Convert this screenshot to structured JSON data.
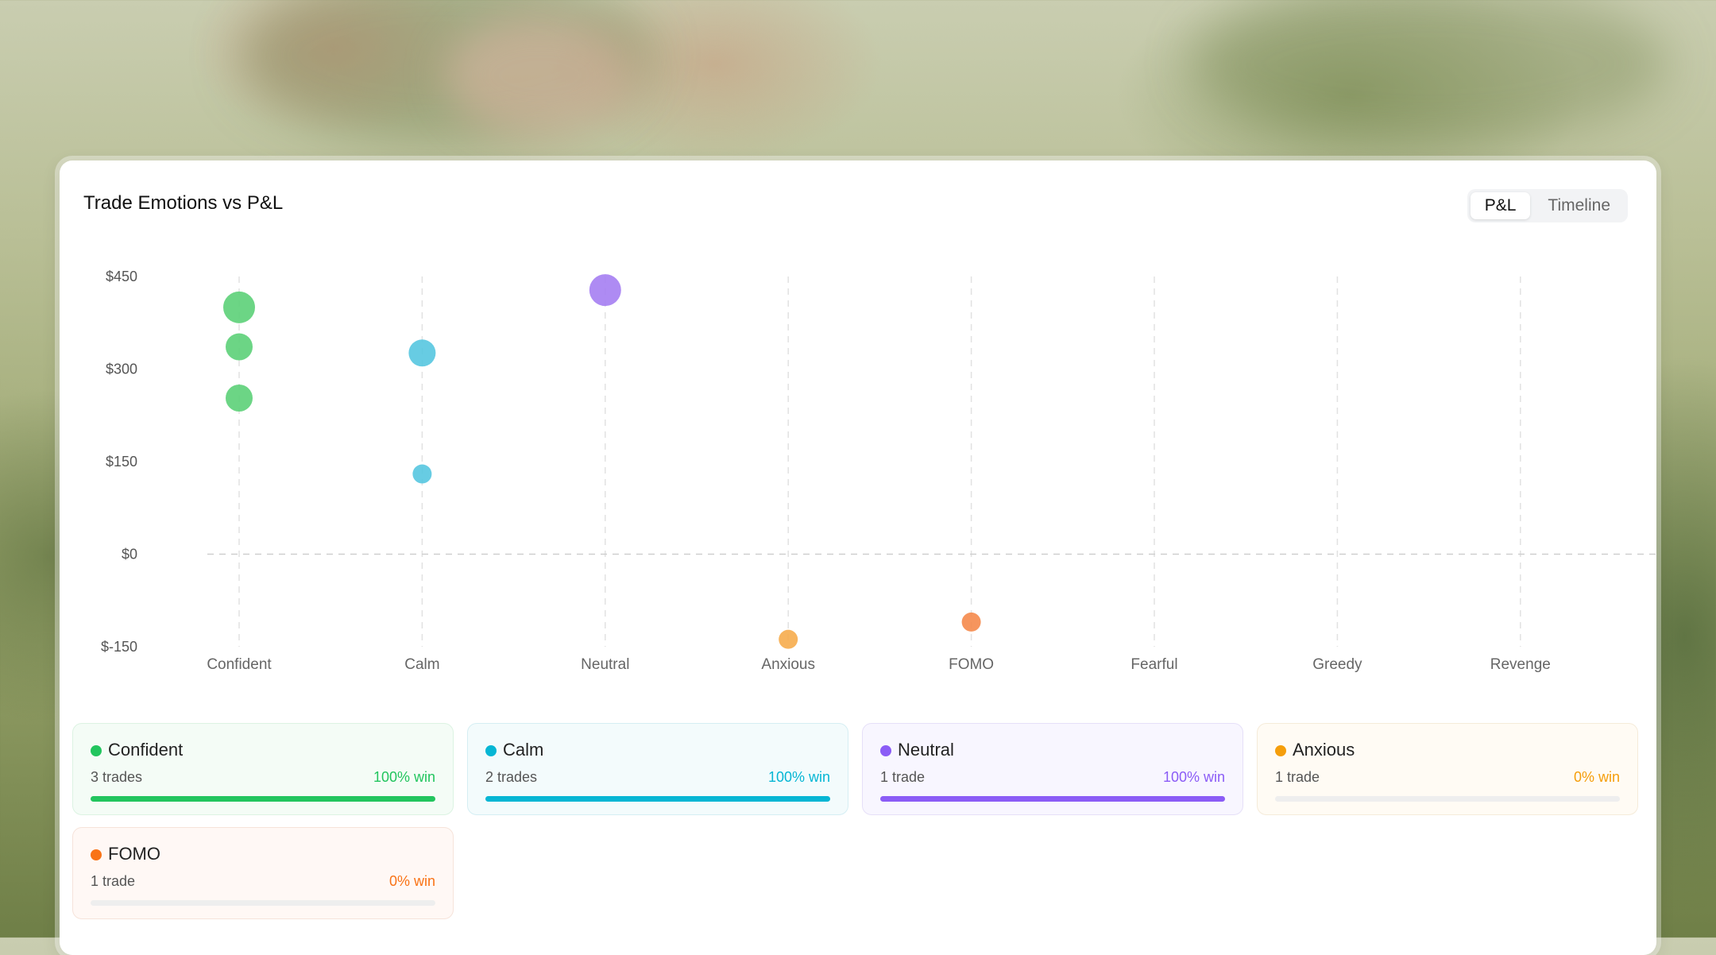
{
  "header": {
    "title": "Trade Emotions vs P&L",
    "tabs": [
      {
        "label": "P&L",
        "active": true
      },
      {
        "label": "Timeline",
        "active": false
      }
    ]
  },
  "chart_data": {
    "type": "scatter",
    "title": "",
    "xlabel": "",
    "ylabel": "",
    "categories": [
      "Confident",
      "Calm",
      "Neutral",
      "Anxious",
      "FOMO",
      "Fearful",
      "Greedy",
      "Revenge"
    ],
    "y_ticks": [
      450,
      300,
      150,
      0,
      -150
    ],
    "y_tick_labels": [
      "$450",
      "$300",
      "$150",
      "$0",
      "$-150"
    ],
    "ylim": [
      -150,
      450
    ],
    "grid": "vertical dashed per category, dashed zero line",
    "colors": {
      "Confident": "#5cd078",
      "Calm": "#56c6e0",
      "Neutral": "#a57ef2",
      "Anxious": "#f6ac4c",
      "FOMO": "#f58a4b"
    },
    "points": [
      {
        "category": "Confident",
        "y": 400,
        "size": "large"
      },
      {
        "category": "Confident",
        "y": 336,
        "size": "medium"
      },
      {
        "category": "Confident",
        "y": 253,
        "size": "medium"
      },
      {
        "category": "Calm",
        "y": 326,
        "size": "medium"
      },
      {
        "category": "Calm",
        "y": 130,
        "size": "small"
      },
      {
        "category": "Neutral",
        "y": 428,
        "size": "large"
      },
      {
        "category": "Anxious",
        "y": -138,
        "size": "small"
      },
      {
        "category": "FOMO",
        "y": -110,
        "size": "small"
      }
    ]
  },
  "stats": [
    {
      "name": "Confident",
      "trades": "3 trades",
      "win": "100% win",
      "win_fraction": 1.0,
      "color": "#22c55e",
      "bg": "#f4fcf6",
      "border": "#dcf3e2"
    },
    {
      "name": "Calm",
      "trades": "2 trades",
      "win": "100% win",
      "win_fraction": 1.0,
      "color": "#06b6d4",
      "bg": "#f3fbfc",
      "border": "#d5eef3"
    },
    {
      "name": "Neutral",
      "trades": "1 trade",
      "win": "100% win",
      "win_fraction": 1.0,
      "color": "#8b5cf6",
      "bg": "#f8f6ff",
      "border": "#e6e0f8"
    },
    {
      "name": "Anxious",
      "trades": "1 trade",
      "win": "0% win",
      "win_fraction": 0.0,
      "color": "#f59e0b",
      "bg": "#fffbf4",
      "border": "#f5ebd9"
    },
    {
      "name": "FOMO",
      "trades": "1 trade",
      "win": "0% win",
      "win_fraction": 0.0,
      "color": "#f97316",
      "bg": "#fff8f5",
      "border": "#f6e3da"
    }
  ]
}
